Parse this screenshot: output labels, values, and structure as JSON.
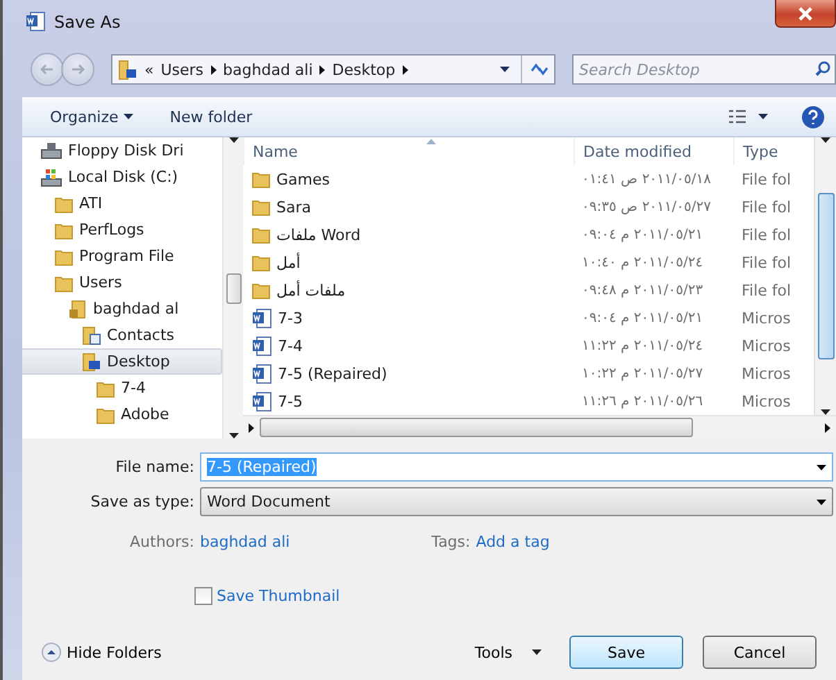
{
  "window": {
    "title": "Save As"
  },
  "nav_buttons": {
    "back_disabled": true,
    "forward_disabled": true
  },
  "address_bar": {
    "overflow": "«",
    "crumbs": [
      "Users",
      "baghdad ali",
      "Desktop"
    ]
  },
  "search": {
    "placeholder": "Search Desktop"
  },
  "toolbar": {
    "buttons": [
      {
        "label": "Organize",
        "dropdown": true
      },
      {
        "label": "New folder",
        "dropdown": false
      }
    ]
  },
  "nav_tree": [
    {
      "label": "Floppy Disk Dri",
      "kind": "floppy",
      "selected": false
    },
    {
      "label": "Local Disk (C:)",
      "kind": "disk",
      "selected": false,
      "children": [
        {
          "label": "ATI",
          "kind": "folder",
          "selected": false
        },
        {
          "label": "PerfLogs",
          "kind": "folder",
          "selected": false
        },
        {
          "label": "Program File",
          "kind": "folder",
          "selected": false
        },
        {
          "label": "Users",
          "kind": "folder",
          "selected": false,
          "children": [
            {
              "label": "baghdad al",
              "kind": "user",
              "selected": false,
              "children": [
                {
                  "label": "Contacts",
                  "kind": "contacts",
                  "selected": false
                },
                {
                  "label": "Desktop",
                  "kind": "desktop",
                  "selected": true,
                  "children": [
                    {
                      "label": "7-4",
                      "kind": "folder",
                      "selected": false
                    },
                    {
                      "label": "Adobe",
                      "kind": "folder",
                      "selected": false
                    }
                  ]
                }
              ]
            }
          ]
        }
      ]
    }
  ],
  "file_list": {
    "columns": [
      "Name",
      "Date modified",
      "Type"
    ],
    "rows": [
      {
        "name": "Games",
        "kind": "folder",
        "date": "٢٠١١/٠٥/١٨ ص ٠١:٤١",
        "type": "File fol"
      },
      {
        "name": "Sara",
        "kind": "folder",
        "date": "٢٠١١/٠٥/٢٧ ص ٠٩:٣٥",
        "type": "File fol"
      },
      {
        "name": "ملفات Word",
        "kind": "folder",
        "date": "٢٠١١/٠٥/٢١ م ٠٩:٠٤",
        "type": "File fol"
      },
      {
        "name": "أمل",
        "kind": "folder",
        "date": "٢٠١١/٠٥/٢٤ م ١٠:٤٠",
        "type": "File fol"
      },
      {
        "name": "ملفات أمل",
        "kind": "folder",
        "date": "٢٠١١/٠٥/٢٣ م ٠٩:٤٨",
        "type": "File fol"
      },
      {
        "name": "7-3",
        "kind": "document",
        "date": "٢٠١١/٠٥/٢١ م ٠٩:٠٤",
        "type": "Micros"
      },
      {
        "name": "7-4",
        "kind": "document",
        "date": "٢٠١١/٠٥/٢٤ م ١١:٢٢",
        "type": "Micros"
      },
      {
        "name": "7-5 (Repaired)",
        "kind": "document",
        "date": "٢٠١١/٠٥/٢٧ م ١٠:٢٢",
        "type": "Micros"
      },
      {
        "name": "7-5",
        "kind": "document",
        "date": "٢٠١١/٠٥/٢٦ م ١١:٢٦",
        "type": "Micros"
      }
    ]
  },
  "file_name": {
    "label": "File name:",
    "value": "7-5 (Repaired)",
    "highlighted": true
  },
  "save_type": {
    "label": "Save as type:",
    "value": "Word Document"
  },
  "authors": {
    "label": "Authors:",
    "value": "baghdad ali"
  },
  "tags": {
    "label": "Tags:",
    "value": "Add a tag"
  },
  "thumbnail": {
    "label": "Save Thumbnail",
    "checked": false
  },
  "hide_folders": {
    "label": "Hide Folders"
  },
  "buttons": [
    {
      "label": "Tools",
      "kind": "menu"
    },
    {
      "label": "Save",
      "kind": "default"
    },
    {
      "label": "Cancel",
      "kind": "normal"
    }
  ]
}
